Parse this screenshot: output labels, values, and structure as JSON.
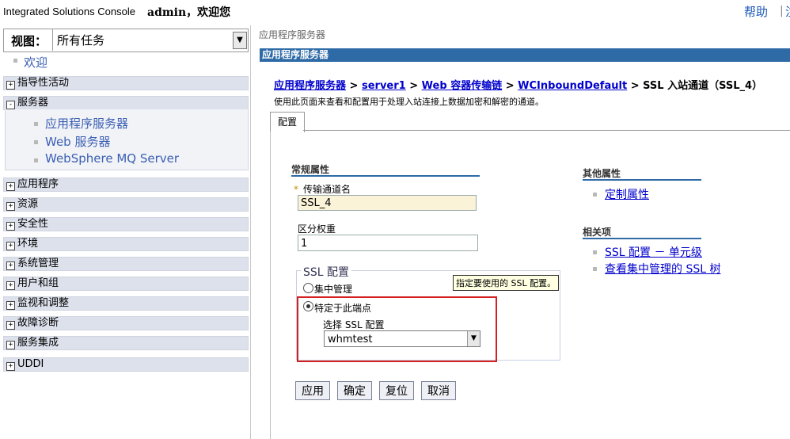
{
  "header": {
    "console_title": "Integrated Solutions Console",
    "welcome": "admin，欢迎您",
    "help": "帮助",
    "separator": "|",
    "logout_partial": "注"
  },
  "view": {
    "label": "视图：",
    "selected": "所有任务"
  },
  "nav": {
    "welcome": "欢迎",
    "sections": [
      {
        "label": "指导性活动",
        "state": "+"
      },
      {
        "label": "服务器",
        "state": "-"
      },
      {
        "label": "应用程序",
        "state": "+"
      },
      {
        "label": "资源",
        "state": "+"
      },
      {
        "label": "安全性",
        "state": "+"
      },
      {
        "label": "环境",
        "state": "+"
      },
      {
        "label": "系统管理",
        "state": "+"
      },
      {
        "label": "用户和组",
        "state": "+"
      },
      {
        "label": "监视和调整",
        "state": "+"
      },
      {
        "label": "故障诊断",
        "state": "+"
      },
      {
        "label": "服务集成",
        "state": "+"
      },
      {
        "label": "UDDI",
        "state": "+"
      }
    ],
    "server_items": [
      "应用程序服务器",
      "Web 服务器",
      "WebSphere MQ Server"
    ]
  },
  "main": {
    "top_breadcrumb": "应用程序服务器",
    "title": "应用程序服务器",
    "path": {
      "link1": "应用程序服务器",
      "link2": "server1",
      "link3": "Web 容器传输链",
      "link4": "WCInboundDefault",
      "current": "SSL 入站通道（SSL_4）",
      "sep": ">"
    },
    "description": "使用此页面来查看和配置用于处理入站连接上数据加密和解密的通道。",
    "tab": "配置",
    "general_props": "常规属性",
    "required_mark": "*",
    "name_label": "传输通道名",
    "name_value": "SSL_4",
    "weight_label": "区分权重",
    "weight_value": "1",
    "ssl_legend": "SSL 配置",
    "radio_central": "集中管理",
    "tooltip": "指定要使用的 SSL 配置。",
    "radio_specific": "特定于此端点",
    "select_label": "选择 SSL 配置",
    "select_value": "whmtest",
    "buttons": {
      "apply": "应用",
      "ok": "确定",
      "reset": "复位",
      "cancel": "取消"
    },
    "other_props": "其他属性",
    "custom_props": "定制属性",
    "related": "相关项",
    "related_links": [
      "SSL 配置 － 单元级",
      "查看集中管理的 SSL 树"
    ]
  },
  "colors": {
    "title_bar": "#2d6aa6",
    "nav_header": "#dde1ec",
    "highlight_box": "#d42020",
    "required_field": "#fbf3d8"
  }
}
